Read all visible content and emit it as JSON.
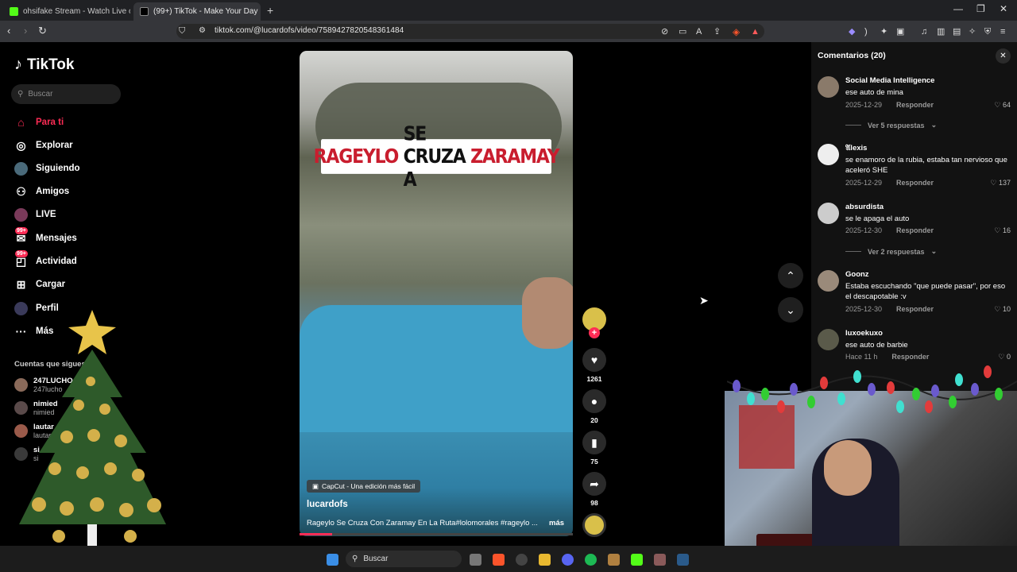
{
  "browser": {
    "tabs": [
      {
        "title": "ohsifake Stream - Watch Live on"
      },
      {
        "title": "(99+) TikTok - Make Your Day"
      }
    ],
    "url": "tiktok.com/@lucardofs/video/7589427820548361484"
  },
  "sidebar": {
    "logo": "TikTok",
    "search_placeholder": "Buscar",
    "items": [
      {
        "label": "Para ti",
        "badge": ""
      },
      {
        "label": "Explorar",
        "badge": ""
      },
      {
        "label": "Siguiendo",
        "badge": ""
      },
      {
        "label": "Amigos",
        "badge": ""
      },
      {
        "label": "LIVE",
        "badge": ""
      },
      {
        "label": "Mensajes",
        "badge": "99+"
      },
      {
        "label": "Actividad",
        "badge": "99+"
      },
      {
        "label": "Cargar",
        "badge": ""
      },
      {
        "label": "Perfil",
        "badge": ""
      },
      {
        "label": "Más",
        "badge": ""
      }
    ],
    "following_title": "Cuentas que sigues",
    "following": [
      {
        "name": "247LUCHO",
        "handle": "247lucho"
      },
      {
        "name": "nimied",
        "handle": "nimied"
      },
      {
        "name": "lautar",
        "handle": "lautaro"
      },
      {
        "name": "si",
        "handle": "si"
      }
    ]
  },
  "video": {
    "headline_white": "RAGEYLO SE CRUZA A",
    "headline_red": "ZARAMAY",
    "headline_red_first": "RAGEYLO",
    "headline_white_rest": "SE CRUZA A",
    "capcut": "CapCut - Una edición más fácil",
    "author": "lucardofs",
    "description": "Rageylo Se Cruza Con Zaramay En La Ruta#lolomorales #rageylo ...",
    "more": "más",
    "progress": 0.12
  },
  "actions": {
    "likes": "1261",
    "comments": "20",
    "saves": "75",
    "shares": "98"
  },
  "comments_panel": {
    "title": "Comentarios (20)",
    "comments": [
      {
        "user": "Social Media Intelligence",
        "text": "ese auto de mina",
        "date": "2025-12-29",
        "reply": "Responder",
        "likes": "64",
        "replies": "Ver 5 respuestas"
      },
      {
        "user": "𝔄lexis",
        "text": "se enamoro de la rubia, estaba tan nervioso que aceleró SHE",
        "date": "2025-12-29",
        "reply": "Responder",
        "likes": "137",
        "replies": ""
      },
      {
        "user": "absurdista",
        "text": "se le apaga el auto",
        "date": "2025-12-30",
        "reply": "Responder",
        "likes": "16",
        "replies": "Ver 2 respuestas"
      },
      {
        "user": "Goonz",
        "text": "Estaba escuchando \"que puede pasar\", por eso el descapotable :v",
        "date": "2025-12-30",
        "reply": "Responder",
        "likes": "10",
        "replies": ""
      },
      {
        "user": "luxoekuxo",
        "text": "ese auto de barbie",
        "date": "Hace 11 h",
        "reply": "Responder",
        "likes": "0",
        "replies": ""
      }
    ]
  },
  "taskbar": {
    "search": "Buscar"
  },
  "colors": {
    "accent": "#fe2c55",
    "panel": "#121212",
    "chrome": "#35363a"
  }
}
